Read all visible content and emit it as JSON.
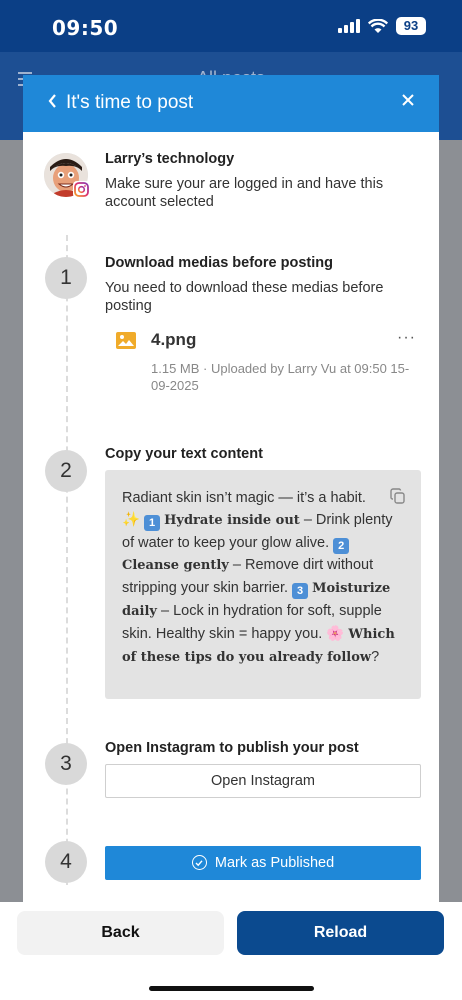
{
  "status_bar": {
    "time": "09:50",
    "battery": "93"
  },
  "behind": {
    "title": "All posts"
  },
  "modal": {
    "title": "It's time to post",
    "back_icon": "chevron-left-icon",
    "close_icon": "close-icon",
    "accent_color": "#1f88d8"
  },
  "account": {
    "name": "Larry’s technology",
    "description": "Make sure your are logged in and have this account selected",
    "platform_icon": "instagram-icon"
  },
  "steps": [
    {
      "number": "1",
      "title": "Download medias before posting",
      "description": "You need to download these medias before posting"
    },
    {
      "number": "2",
      "title": "Copy your text content"
    },
    {
      "number": "3",
      "title": "Open Instagram to publish your post",
      "button_label": "Open Instagram"
    },
    {
      "number": "4",
      "button_label": "Mark as Published"
    }
  ],
  "media": {
    "file_name": "4.png",
    "meta": "1.15 MB · Uploaded by Larry Vu at 09:50 15-09-2025",
    "menu": "···"
  },
  "post_text": {
    "intro": "Radiant skin isn’t magic — it’s a habit.",
    "sparkle": "✨",
    "k1": "1",
    "t1_bold": "Hydrate inside out",
    "t1": " – Drink plenty of water to keep your glow alive.",
    "k2": "2",
    "t2_bold": "Cleanse gently",
    "t2": " – Remove dirt without stripping your skin barrier.",
    "k3": "3",
    "t3_bold": "Moisturize daily",
    "t3": " – Lock in hydration for soft, supple skin. Healthy skin = happy you.",
    "flower": "🌸",
    "question_bold": "Which of these tips do you already follow",
    "question_mark": "?"
  },
  "footer": {
    "back_label": "Back",
    "reload_label": "Reload"
  }
}
